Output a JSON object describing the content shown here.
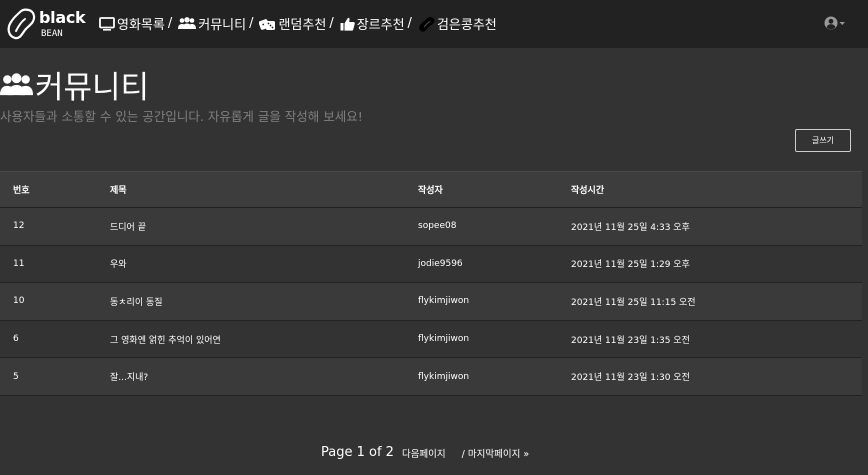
{
  "navbar": {
    "logo_top": "black",
    "logo_bottom": "BEAN",
    "items": [
      {
        "label": "영화목록",
        "sep": "/",
        "icon": "monitor-icon"
      },
      {
        "label": "커뮤니티",
        "sep": "/",
        "icon": "users-icon"
      },
      {
        "label": "랜덤추천",
        "sep": "/",
        "icon": "dice-icon"
      },
      {
        "label": "장르추천",
        "sep": "/",
        "icon": "thumbs-up-icon"
      },
      {
        "label": "검은콩추천",
        "sep": "",
        "icon": "bean-icon"
      }
    ],
    "user_icon": "user-circle-icon"
  },
  "header": {
    "title": "커뮤니티",
    "subtitle": "사용자들과 소통할 수 있는 공간입니다. 자유롭게 글을 작성해 보세요!",
    "write_button": "글쓰기"
  },
  "table": {
    "columns": [
      "번호",
      "제목",
      "작성자",
      "작성시간"
    ],
    "rows": [
      {
        "num": "12",
        "title": "드디어 끝",
        "writer": "sopee08",
        "time": "2021년 11월 25일 4:33 오후"
      },
      {
        "num": "11",
        "title": "우와",
        "writer": "jodie9596",
        "time": "2021년 11월 25일 1:29 오후"
      },
      {
        "num": "10",
        "title": "동ㅊ리이 동질",
        "writer": "flykimjiwon",
        "time": "2021년 11월 25일 11:15 오전"
      },
      {
        "num": "6",
        "title": "그 영화엔 얽힌 추억이 있어연",
        "writer": "flykimjiwon",
        "time": "2021년 11월 23일 1:35 오전"
      },
      {
        "num": "5",
        "title": "잘...지내?",
        "writer": "flykimjiwon",
        "time": "2021년 11월 23일 1:30 오전"
      }
    ]
  },
  "pagination": {
    "current": "Page 1 of 2",
    "next": "다음페이지",
    "last": "/ 마지막페이지 »"
  },
  "colors": {
    "navbar_bg": "#222222",
    "page_bg": "#333333",
    "subtitle": "#7f7f7f"
  }
}
